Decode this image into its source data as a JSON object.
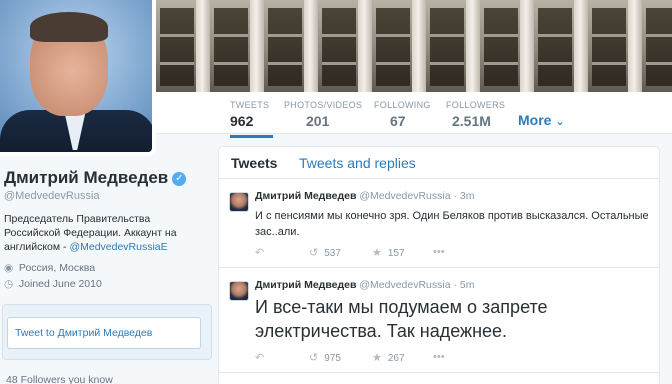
{
  "profile": {
    "name": "Дмитрий Медведев",
    "verified_mark": "✓",
    "handle": "@MedvedevRussia",
    "bio_text": "Председатель Правительства Российской Федерации. Аккаунт на английском - ",
    "bio_link": "@MedvedevRussiaE",
    "location": "Россия, Москва",
    "joined": "Joined June 2010",
    "tweet_to": "Tweet to Дмитрий Медведев",
    "followers_you_know": "48 Followers you know"
  },
  "nav": {
    "stats": [
      {
        "label": "TWEETS",
        "value": "962"
      },
      {
        "label": "PHOTOS/VIDEOS",
        "value": "201"
      },
      {
        "label": "FOLLOWING",
        "value": "67"
      },
      {
        "label": "FOLLOWERS",
        "value": "2.51M"
      }
    ],
    "more": "More"
  },
  "tabs": {
    "tweets": "Tweets",
    "replies": "Tweets and replies"
  },
  "tweets": [
    {
      "name": "Дмитрий Медведев",
      "handle": "@MedvedevRussia",
      "dot": "·",
      "time": "3m",
      "text": "И с пенсиями мы конечно зря. Один Беляков против высказался. Остальные зас..али.",
      "retweets": "537",
      "favorites": "157"
    },
    {
      "name": "Дмитрий Медведев",
      "handle": "@MedvedevRussia",
      "dot": "·",
      "time": "5m",
      "text": "И все-таки мы подумаем о запрете электричества. Так надежнее.",
      "retweets": "975",
      "favorites": "267"
    }
  ],
  "icons": {
    "reply": "reply-icon",
    "retweet": "retweet-icon",
    "favorite": "star-icon",
    "more": "ellipsis-icon",
    "location": "location-pin-icon",
    "joined": "clock-icon"
  },
  "colors": {
    "link": "#2b7bb9",
    "verified": "#55acee",
    "muted": "#8899a6"
  }
}
